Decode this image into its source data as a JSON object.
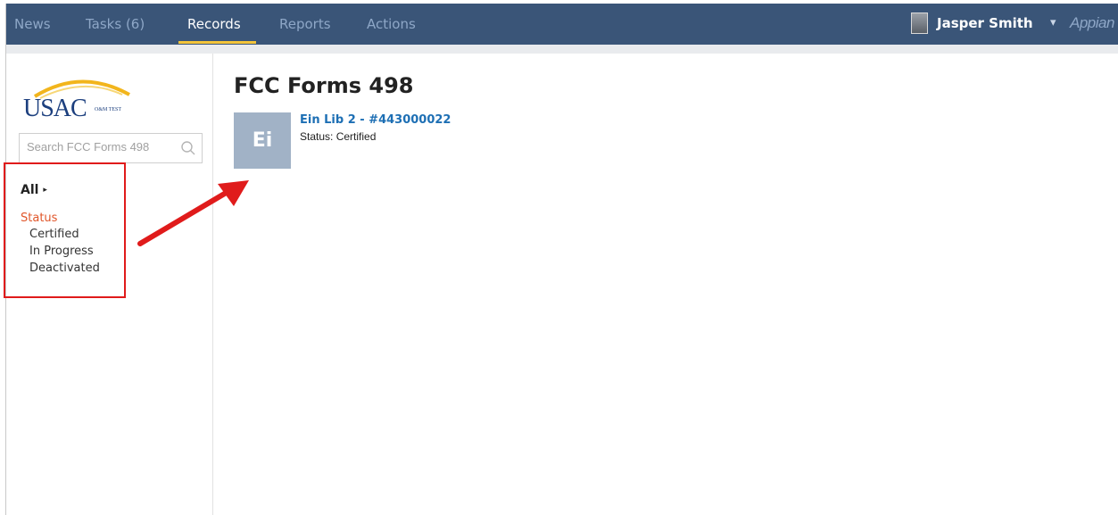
{
  "nav": {
    "tabs": [
      {
        "label": "News"
      },
      {
        "label": "Tasks (6)"
      },
      {
        "label": "Records"
      },
      {
        "label": "Reports"
      },
      {
        "label": "Actions"
      }
    ],
    "active_tab": "Records",
    "user_name": "Jasper Smith",
    "user_caret": "▾",
    "brand": "Appian"
  },
  "sidebar": {
    "logo": {
      "main": "USAC",
      "sub": "O&M TEST"
    },
    "search": {
      "placeholder": "Search FCC Forms 498"
    },
    "facets": {
      "all_label": "All",
      "all_arrow": "▸",
      "status_heading": "Status",
      "items": [
        {
          "label": "Certified"
        },
        {
          "label": "In Progress"
        },
        {
          "label": "Deactivated"
        }
      ]
    }
  },
  "main": {
    "title": "FCC Forms 498",
    "records": [
      {
        "thumb": "Ei",
        "title": "Ein Lib 2 - #443000022",
        "status": "Status: Certified"
      }
    ]
  },
  "colors": {
    "topbar": "#3a5578",
    "active_underline": "#f3c43a",
    "link": "#1d6fb4",
    "facet_heading": "#e0562a",
    "annotation": "#e01b1b",
    "thumb": "#a1b2c6"
  }
}
